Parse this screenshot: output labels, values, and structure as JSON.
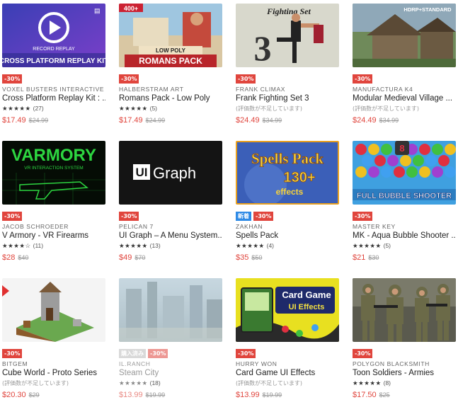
{
  "cards": [
    {
      "thumb_text": "CROSS PLATFORM REPLAY KIT",
      "thumb_sub": "RECORD  REPLAY",
      "badges": [
        "-30%"
      ],
      "publisher": "VOXEL BUSTERS INTERACTIVE",
      "title": "Cross Platform Replay Kit : ...",
      "stars": "★★★★★",
      "count": "(27)",
      "price": "$17.49",
      "old_price": "$24.99"
    },
    {
      "thumb_text": "ROMANS PACK",
      "thumb_sub": "LOW POLY",
      "thumb_corner": "400+",
      "badges": [
        "-30%"
      ],
      "publisher": "HALBERSTRAM ART",
      "title": "Romans Pack - Low Poly",
      "stars": "★★★★★",
      "count": "(5)",
      "price": "$17.49",
      "old_price": "$24.99"
    },
    {
      "thumb_text": "Fighting Set",
      "thumb_sub": "3",
      "badges": [
        "-30%"
      ],
      "publisher": "FRANK CLIMAX",
      "title": "Frank Fighting Set 3",
      "norating": "(評価数が不足しています)",
      "price": "$24.49",
      "old_price": "$34.99"
    },
    {
      "thumb_text": "HDRP+STANDARD",
      "badges": [
        "-30%"
      ],
      "publisher": "MANUFACTURA K4",
      "title": "Modular Medieval Village ...",
      "norating": "(評価数が不足しています)",
      "price": "$24.49",
      "old_price": "$34.99"
    },
    {
      "thumb_text": "VARMORY",
      "thumb_sub": "VR INTERACTION SYSTEM",
      "badges": [
        "-30%"
      ],
      "publisher": "JACOB SCHROEDER",
      "title": "V Armory - VR Firearms",
      "stars": "★★★★☆",
      "count": "(11)",
      "price": "$28",
      "old_price": "$40"
    },
    {
      "thumb_text": "Graph",
      "thumb_sub": "UI",
      "badges": [
        "-30%"
      ],
      "publisher": "PELICAN 7",
      "title": "UI Graph – A Menu System...",
      "stars": "★★★★★",
      "count": "(13)",
      "price": "$49",
      "old_price": "$70"
    },
    {
      "thumb_text": "Spells Pack",
      "thumb_sub": "130+",
      "thumb_sub2": "effects",
      "badges": [
        "新着",
        "-30%"
      ],
      "publisher": "ZAKHAN",
      "title": "Spells Pack",
      "stars": "★★★★★",
      "count": "(4)",
      "price": "$35",
      "old_price": "$50"
    },
    {
      "thumb_text": "FULL BUBBLE SHOOTER",
      "badges": [
        "-30%"
      ],
      "publisher": "MASTER KEY",
      "title": "MK - Aqua Bubble Shooter ...",
      "stars": "★★★★★",
      "count": "(5)",
      "price": "$21",
      "old_price": "$30"
    },
    {
      "badges": [
        "-30%"
      ],
      "publisher": "BITGEM",
      "title": "Cube World - Proto Series",
      "norating": "(評価数が不足しています)",
      "price": "$20.30",
      "old_price": "$29"
    },
    {
      "badges": [
        "購入済み",
        "-30%"
      ],
      "publisher": "IL.RANCH",
      "title": "Steam City",
      "stars": "★★★★★",
      "count": "(18)",
      "price": "$13.99",
      "old_price": "$19.99",
      "dim": true
    },
    {
      "thumb_text": "Card Game",
      "thumb_sub": "UI Effects",
      "badges": [
        "-30%"
      ],
      "publisher": "HURRY WON",
      "title": "Card Game UI Effects",
      "norating": "(評価数が不足しています)",
      "price": "$13.99",
      "old_price": "$19.99"
    },
    {
      "badges": [
        "-30%"
      ],
      "publisher": "POLYGON BLACKSMITH",
      "title": "Toon Soldiers - Armies",
      "stars": "★★★★★",
      "count": "(8)",
      "price": "$17.50",
      "old_price": "$25"
    }
  ],
  "colors": {
    "sale": "#e0453d",
    "new": "#2e8ae6",
    "owned": "#bbbbbb"
  }
}
